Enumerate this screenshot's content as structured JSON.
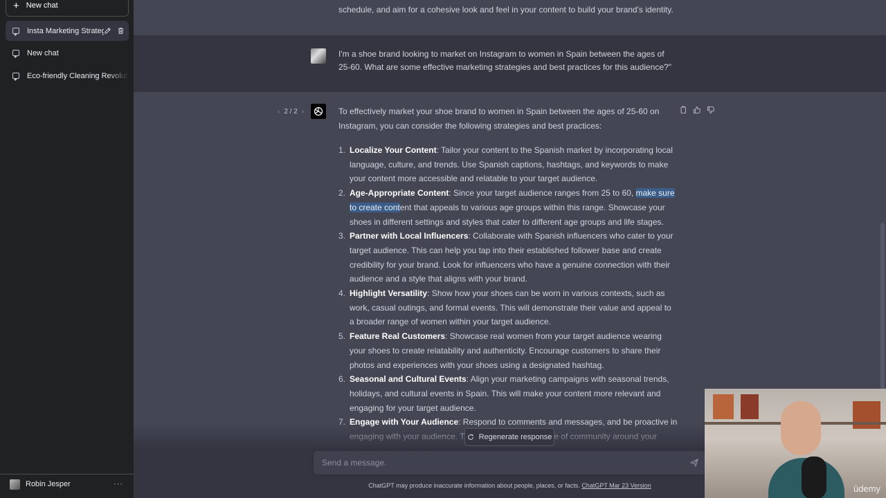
{
  "sidebar": {
    "new_chat_label": "New chat",
    "conversations": [
      {
        "label": "Insta Marketing Strateg",
        "active": true
      },
      {
        "label": "New chat",
        "active": false
      },
      {
        "label": "Eco-friendly Cleaning Revolut",
        "active": false
      }
    ],
    "user_name": "Robin Jesper",
    "more_label": "···"
  },
  "chat": {
    "prev_tail": "schedule, and aim for a cohesive look and feel in your content to build your brand's identity.",
    "user_message": "I'm a shoe brand looking to market on Instagram to women in Spain between the ages of 25-60. What are some effective marketing strategies and best practices for this audience?\"",
    "pager": {
      "prev": "‹",
      "label": "2 / 2",
      "next": "›"
    },
    "assistant_intro": "To effectively market your shoe brand to women in Spain between the ages of 25-60 on Instagram, you can consider the following strategies and best practices:",
    "points": [
      {
        "num": "1.",
        "title": "Localize Your Content",
        "body": ": Tailor your content to the Spanish market by incorporating local language, culture, and trends. Use Spanish captions, hashtags, and keywords to make your content more accessible and relatable to your target audience."
      },
      {
        "num": "2.",
        "title": "Age-Appropriate Content",
        "body_before": ": Since your target audience ranges from 25 to 60, ",
        "highlight": "make sure to create cont",
        "body_after": "ent that appeals to various age groups within this range. Showcase your shoes in different settings and styles that cater to different age groups and life stages."
      },
      {
        "num": "3.",
        "title": "Partner with Local Influencers",
        "body": ": Collaborate with Spanish influencers who cater to your target audience. This can help you tap into their established follower base and create credibility for your brand. Look for influencers who have a genuine connection with their audience and a style that aligns with your brand."
      },
      {
        "num": "4.",
        "title": "Highlight Versatility",
        "body": ": Show how your shoes can be worn in various contexts, such as work, casual outings, and formal events. This will demonstrate their value and appeal to a broader range of women within your target audience."
      },
      {
        "num": "5.",
        "title": "Feature Real Customers",
        "body": ": Showcase real women from your target audience wearing your shoes to create relatability and authenticity. Encourage customers to share their photos and experiences with your shoes using a designated hashtag."
      },
      {
        "num": "6.",
        "title": "Seasonal and Cultural Events",
        "body": ": Align your marketing campaigns with seasonal trends, holidays, and cultural events in Spain. This will make your content more relevant and engaging for your target audience."
      },
      {
        "num": "7.",
        "title": "Engage with Your Audience",
        "body": ": Respond to comments and messages, and be proactive in engaging with your audience. This will help build a sense of community around your brand and foster loyalty."
      }
    ]
  },
  "composer": {
    "regenerate_label": "Regenerate response",
    "placeholder": "Send a message.",
    "disclaimer": "ChatGPT may produce inaccurate information about people, places, or facts.",
    "version_link": "ChatGPT Mar 23 Version"
  },
  "webcam": {
    "watermark": "ūdemy"
  },
  "colors": {
    "sidebar_bg": "#202123",
    "main_bg": "#343541",
    "assistant_bg": "#444654",
    "highlight": "#3b5d8a"
  }
}
